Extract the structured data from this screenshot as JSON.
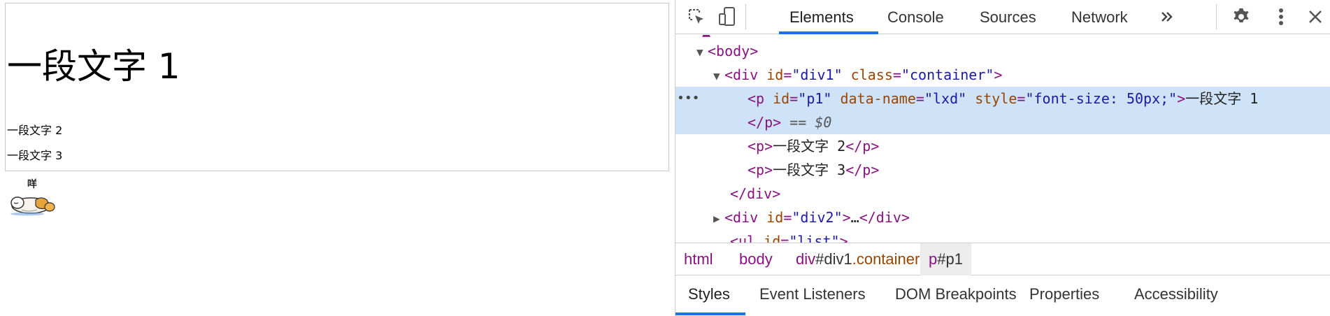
{
  "page": {
    "div1": {
      "p1": "一段文字 1",
      "p2": "一段文字 2",
      "p3": "一段文字 3"
    },
    "sticker_caption": "咩"
  },
  "devtools": {
    "tabs": [
      "Elements",
      "Console",
      "Sources",
      "Network"
    ],
    "active_tab": "Elements",
    "more_tabs_icon": "chevron-double-right-icon",
    "icons": [
      "inspect-element-icon",
      "device-toolbar-icon",
      "settings-gear-icon",
      "more-vertical-icon",
      "close-icon"
    ],
    "dom": {
      "body_tag": "<body>",
      "div1_open": {
        "tag": "div",
        "id_attr": "id",
        "id_val": "div1",
        "class_attr": "class",
        "class_val": "container"
      },
      "selected_p": {
        "tag": "p",
        "id_attr": "id",
        "id_val": "p1",
        "data_attr": "data-name",
        "data_val": "lxd",
        "style_attr": "style",
        "style_val": "font-size: 50px;",
        "text": "一段文字 1",
        "close": "</p>",
        "console_ref": "== $0"
      },
      "p2_text": "一段文字 2",
      "p3_text": "一段文字 3",
      "div1_close": "</div>",
      "div2": {
        "id_attr": "id",
        "id_val": "div2",
        "ellipsis": "…",
        "close": "</div>"
      },
      "ul_partial": {
        "id_attr": "id",
        "id_val": "list"
      }
    },
    "breadcrumbs": [
      {
        "tag": "html"
      },
      {
        "tag": "body"
      },
      {
        "tag": "div",
        "id": "#div1",
        "cls": ".container"
      },
      {
        "tag": "p",
        "id": "#p1"
      }
    ],
    "bottom_tabs": [
      "Styles",
      "Event Listeners",
      "DOM Breakpoints",
      "Properties",
      "Accessibility"
    ],
    "active_bottom_tab": "Styles",
    "colors": {
      "accent": "#1a73e8",
      "tag": "#881280",
      "attr": "#994500",
      "value": "#1a1aa6",
      "selection": "#cfe3f8"
    }
  }
}
